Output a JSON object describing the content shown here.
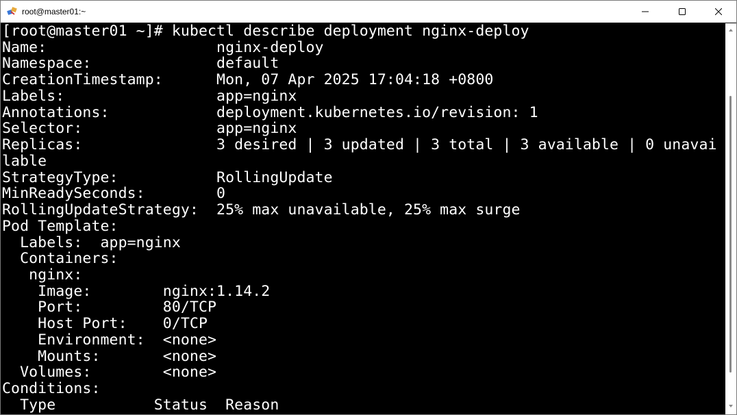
{
  "window": {
    "title": "root@master01:~",
    "accent": "#000000"
  },
  "icons": {
    "app": "putty-icon",
    "minimize": "minimize-icon",
    "maximize": "maximize-icon",
    "close": "close-icon"
  },
  "terminal": {
    "lines": [
      "[root@master01 ~]# kubectl describe deployment nginx-deploy",
      "Name:                   nginx-deploy",
      "Namespace:              default",
      "CreationTimestamp:      Mon, 07 Apr 2025 17:04:18 +0800",
      "Labels:                 app=nginx",
      "Annotations:            deployment.kubernetes.io/revision: 1",
      "Selector:               app=nginx",
      "Replicas:               3 desired | 3 updated | 3 total | 3 available | 0 unavai",
      "lable",
      "StrategyType:           RollingUpdate",
      "MinReadySeconds:        0",
      "RollingUpdateStrategy:  25% max unavailable, 25% max surge",
      "Pod Template:",
      "  Labels:  app=nginx",
      "  Containers:",
      "   nginx:",
      "    Image:        nginx:1.14.2",
      "    Port:         80/TCP",
      "    Host Port:    0/TCP",
      "    Environment:  <none>",
      "    Mounts:       <none>",
      "  Volumes:        <none>",
      "Conditions:",
      "  Type           Status  Reason"
    ]
  }
}
